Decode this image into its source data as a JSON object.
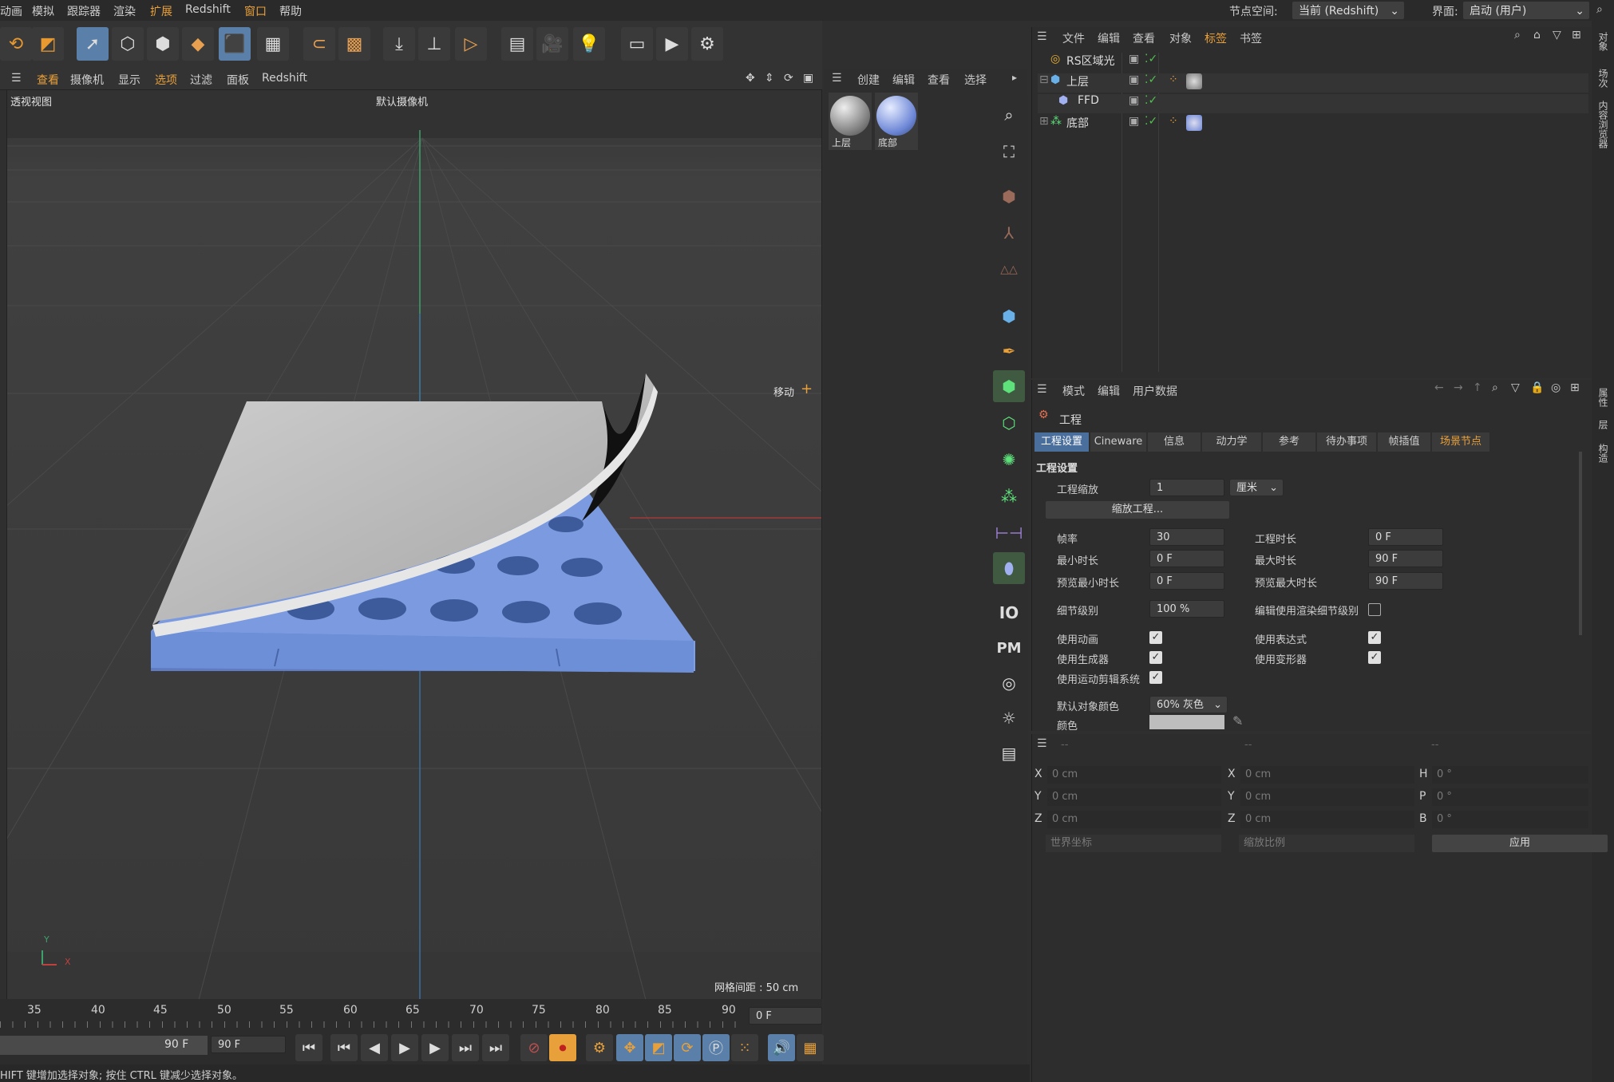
{
  "menu": {
    "items": [
      "动画",
      "模拟",
      "跟踪器",
      "渲染",
      "扩展",
      "Redshift",
      "窗口",
      "帮助"
    ],
    "node_space_label": "节点空间:",
    "node_space_value": "当前 (Redshift)",
    "interface_label": "界面:",
    "interface_value": "启动 (用户)"
  },
  "viewport_menu": {
    "items": [
      "查看",
      "摄像机",
      "显示",
      "选项",
      "过滤",
      "面板",
      "Redshift"
    ]
  },
  "viewport": {
    "view_name": "透视视图",
    "camera": "默认摄像机",
    "move_label": "移动",
    "grid_spacing": "网格间距 : 50 cm",
    "axis_y": "Y",
    "axis_x": "X"
  },
  "materials": {
    "menu": [
      "创建",
      "编辑",
      "查看",
      "选择"
    ],
    "items": [
      {
        "name": "上层"
      },
      {
        "name": "底部"
      }
    ]
  },
  "object_manager": {
    "menu": [
      "文件",
      "编辑",
      "查看",
      "对象",
      "标签",
      "书签"
    ],
    "objects": [
      {
        "name": "RS区域光"
      },
      {
        "name": "上层"
      },
      {
        "name": "FFD"
      },
      {
        "name": "底部"
      }
    ]
  },
  "attributes": {
    "menu": [
      "模式",
      "编辑",
      "用户数据"
    ],
    "title": "工程",
    "tabs": [
      "工程设置",
      "Cineware",
      "信息",
      "动力学",
      "参考",
      "待办事项",
      "帧插值",
      "场景节点"
    ],
    "section": "工程设置",
    "scale_label": "工程缩放",
    "scale_value": "1",
    "scale_unit": "厘米",
    "scale_button": "缩放工程...",
    "fps_label": "帧率",
    "fps_value": "30",
    "duration_label": "工程时长",
    "duration_value": "0 F",
    "min_time_label": "最小时长",
    "min_time_value": "0 F",
    "max_time_label": "最大时长",
    "max_time_value": "90 F",
    "preview_min_label": "预览最小时长",
    "preview_min_value": "0 F",
    "preview_max_label": "预览最大时长",
    "preview_max_value": "90 F",
    "lod_label": "细节级别",
    "lod_value": "100 %",
    "render_lod_label": "编辑使用渲染细节级别",
    "use_anim_label": "使用动画",
    "use_expr_label": "使用表达式",
    "use_gen_label": "使用生成器",
    "use_deform_label": "使用变形器",
    "use_motion_label": "使用运动剪辑系统",
    "default_color_label": "默认对象颜色",
    "default_color_value": "60% 灰色",
    "color_label": "颜色"
  },
  "coordinates": {
    "header": [
      "--",
      "--",
      "--"
    ],
    "rows": [
      {
        "a": "X",
        "av": "0 cm",
        "b": "X",
        "bv": "0 cm",
        "c": "H",
        "cv": "0 °"
      },
      {
        "a": "Y",
        "av": "0 cm",
        "b": "Y",
        "bv": "0 cm",
        "c": "P",
        "cv": "0 °"
      },
      {
        "a": "Z",
        "av": "0 cm",
        "b": "Z",
        "bv": "0 cm",
        "c": "B",
        "cv": "0 °"
      }
    ],
    "world": "世界坐标",
    "scale": "缩放比例",
    "apply": "应用"
  },
  "timeline": {
    "ticks": [
      "35",
      "40",
      "45",
      "50",
      "55",
      "60",
      "65",
      "70",
      "75",
      "80",
      "85",
      "90"
    ],
    "current": "0 F",
    "end_left": "90 F",
    "end_right": "90 F"
  },
  "status": "HIFT 键增加选择对象; 按住 CTRL 键减少选择对象。",
  "right_tabs": [
    "对象",
    "场次",
    "内容浏览器",
    "属性",
    "层",
    "构造"
  ],
  "side_text": {
    "io": "IO",
    "pm": "PM"
  }
}
